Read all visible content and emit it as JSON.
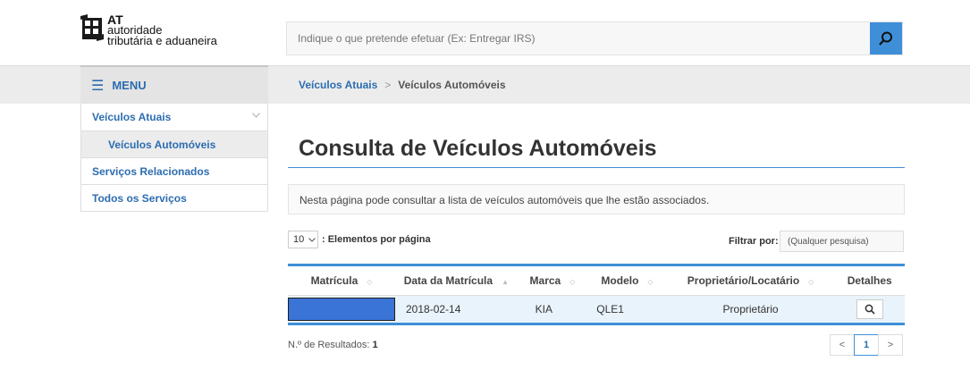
{
  "header": {
    "logo_at": "AT",
    "logo_line1": "autoridade",
    "logo_line2": "tributária e aduaneira",
    "search_placeholder": "Indique o que pretende efetuar (Ex: Entregar IRS)"
  },
  "nav": {
    "menu_label": "MENU",
    "breadcrumb_link": "Veículos Atuais",
    "breadcrumb_sep": ">",
    "breadcrumb_current": "Veículos Automóveis"
  },
  "sidebar": {
    "items": [
      {
        "label": "Veículos Atuais"
      },
      {
        "label": "Veículos Automóveis"
      },
      {
        "label": "Serviços Relacionados"
      },
      {
        "label": "Todos os Serviços"
      }
    ]
  },
  "main": {
    "title": "Consulta de Veículos Automóveis",
    "info": "Nesta página pode consultar a lista de veículos automóveis que lhe estão associados.",
    "per_page_value": "10",
    "per_page_label": ": Elementos por página",
    "filter_label": "Filtrar por:",
    "filter_placeholder": "(Qualquer pesquisa)"
  },
  "table": {
    "columns": [
      "Matrícula",
      "Data da Matrícula",
      "Marca",
      "Modelo",
      "Proprietário/Locatário",
      "Detalhes"
    ],
    "rows": [
      {
        "matricula": "",
        "data": "2018-02-14",
        "marca": "KIA",
        "modelo": "QLE1",
        "proprietario": "Proprietário"
      }
    ]
  },
  "footer": {
    "results_label": "N.º de Resultados:",
    "results_count": "1",
    "page_prev": "<",
    "page_current": "1",
    "page_next": ">"
  },
  "colors": {
    "accent": "#3f8fd8",
    "link": "#2c6db0",
    "redaction": "#3a74d6"
  }
}
